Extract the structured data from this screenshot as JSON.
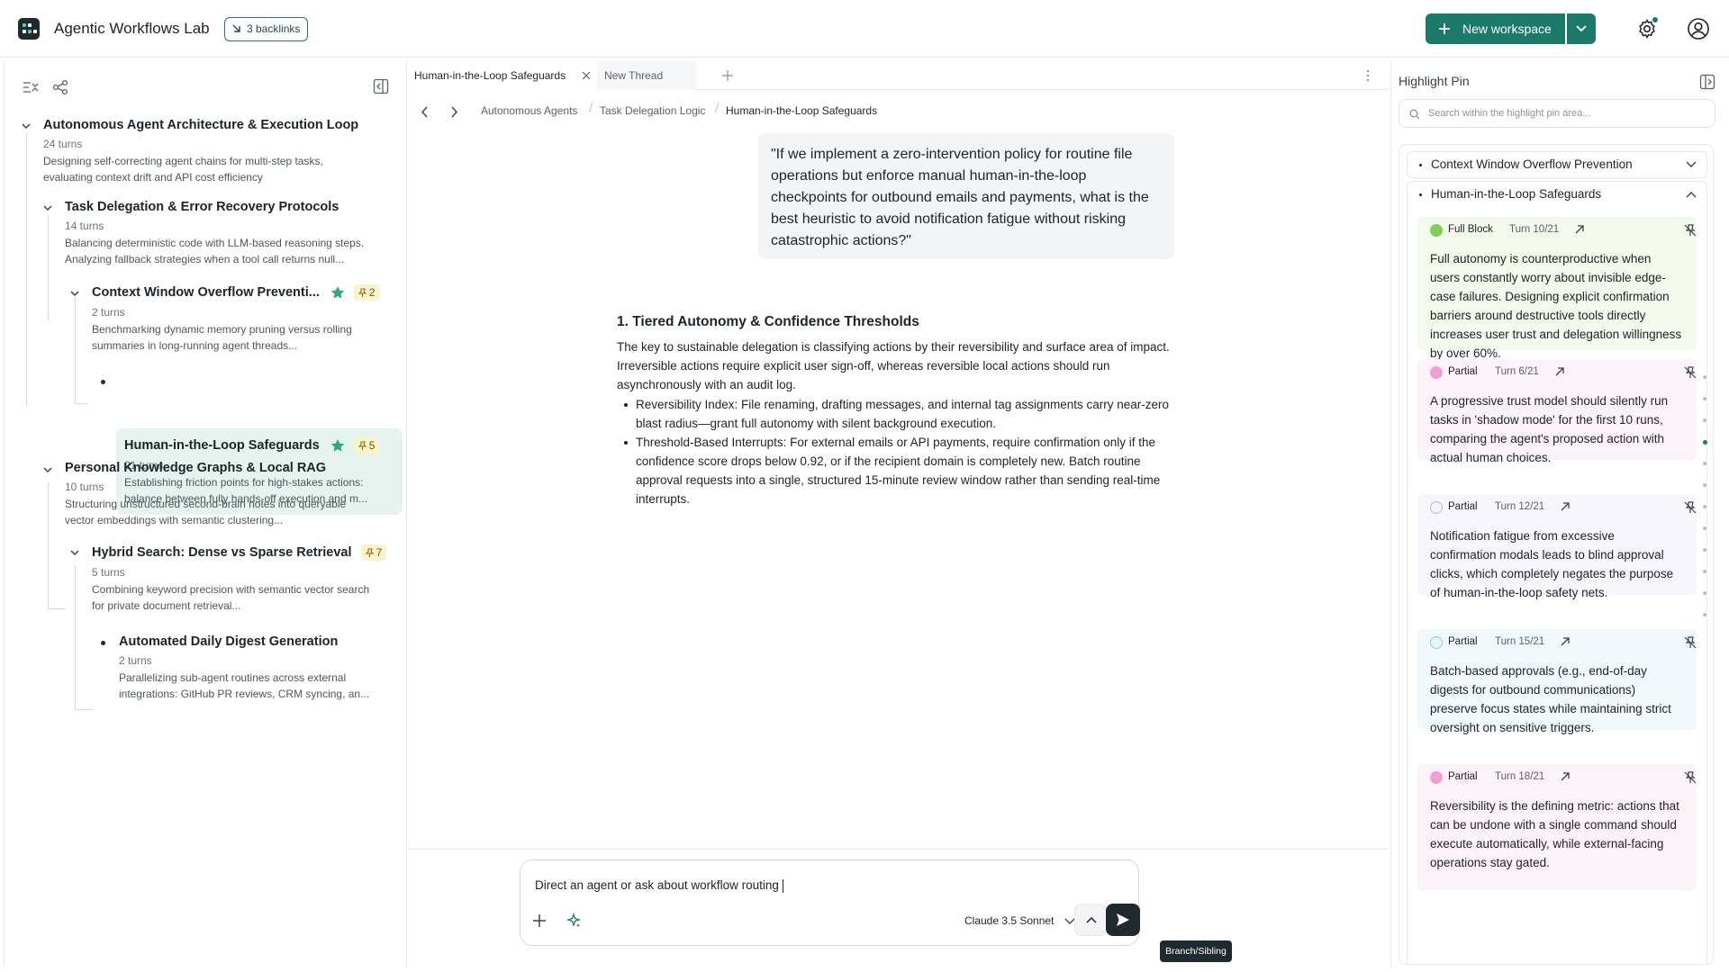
{
  "app": {
    "title": "Agentic Workflows Lab",
    "backlinks": "3 backlinks"
  },
  "toolbar": {
    "new_workspace": "New workspace"
  },
  "tree": [
    {
      "title": "Autonomous Agent Architecture & Execution Loop",
      "turns": "24 turns",
      "desc": "Designing self-correcting agent chains for multi-step tasks, evaluating context drift and API cost efficiency"
    },
    {
      "title": "Task Delegation & Error Recovery Protocols",
      "turns": "14 turns",
      "desc": "Balancing deterministic code with LLM-based reasoning steps. Analyzing fallback strategies when a tool call returns null..."
    },
    {
      "title": "Context Window Overflow Preventi...",
      "turns": "2 turns",
      "desc": "Benchmarking dynamic memory pruning versus rolling summaries in long-running agent threads...",
      "pins": "2"
    },
    {
      "title": "Human-in-the-Loop Safeguards",
      "turns": "21 turns",
      "desc": "Establishing friction points for high-stakes actions: balance between fully hands-off execution and m...",
      "pins": "5"
    },
    {
      "title": "Personal Knowledge Graphs & Local RAG",
      "turns": "10 turns",
      "desc": "Structuring unstructured second-brain notes into queryable vector embeddings with semantic clustering..."
    },
    {
      "title": "Hybrid Search: Dense vs Sparse Retrieval",
      "turns": "5 turns",
      "desc": "Combining keyword precision with semantic vector search for private document retrieval...",
      "pins": "7"
    },
    {
      "title": "Automated Daily Digest Generation",
      "turns": "2 turns",
      "desc": "Parallelizing sub-agent routines across external integrations: GitHub PR reviews, CRM syncing, an..."
    }
  ],
  "tabs": [
    "Human-in-the-Loop Safeguards",
    "New Thread"
  ],
  "breadcrumbs": [
    "Autonomous Agents",
    "Task Delegation Logic",
    "Human-in-the-Loop Safeguards"
  ],
  "chat": {
    "user_quote": "\"If we implement a zero-intervention policy for routine file operations but enforce manual human-in-the-loop checkpoints for outbound emails and payments, what is the best heuristic to avoid notification fatigue without risking catastrophic actions?\"",
    "heading": "1. Tiered Autonomy & Confidence Thresholds",
    "paragraph": "The key to sustainable delegation is classifying actions by their reversibility and surface area of impact. Irreversible actions require explicit user sign-off, whereas reversible local actions should run asynchronously with an audit log.",
    "bullets": [
      "Reversibility Index: File renaming, drafting messages, and internal tag assignments carry near-zero blast radius—grant full autonomy with silent background execution.",
      "Threshold-Based Interrupts: For external emails or API payments, require confirmation only if the confidence score drops below 0.92, or if the recipient domain is completely new. Batch routine approval requests into a single, structured 15-minute review window rather than sending real-time interrupts."
    ]
  },
  "composer": {
    "text": "Direct an agent or ask about workflow routing",
    "model": "Claude 3.5 Sonnet",
    "tooltip": "Branch/Sibling"
  },
  "pin_panel": {
    "title": "Highlight Pin",
    "search_placeholder": "Search within the highlight pin area...",
    "sections": [
      "Context Window Overflow Prevention",
      "Human-in-the-Loop Safeguards"
    ],
    "cards": [
      {
        "tag": "Full Block",
        "turn": "Turn 10/21",
        "color": "#7fcf5a",
        "bg": "#f3f9ec",
        "text": "Full autonomy is counterproductive when users constantly worry about invisible edge-case failures. Designing explicit confirmation barriers around destructive tools directly increases user trust and delegation willingness by over 60%."
      },
      {
        "tag": "Partial",
        "turn": "Turn 6/21",
        "color": "#f0a0d0",
        "bg": "#fbf3f8",
        "text": "A progressive trust model should silently run tasks in 'shadow mode' for the first 10 runs, comparing the agent's proposed action with actual human choices."
      },
      {
        "tag": "Partial",
        "turn": "Turn 12/21",
        "color": "#e6e2f4",
        "bg": "#f7f6fc",
        "text": "Notification fatigue from excessive confirmation modals leads to blind approval clicks, which completely negates the purpose of human-in-the-loop safety nets."
      },
      {
        "tag": "Partial",
        "turn": "Turn 15/21",
        "color": "#d4eef6",
        "bg": "#f0f8fb",
        "text": "Batch-based approvals (e.g., end-of-day digests for outbound communications) preserve focus states while maintaining strict oversight on sensitive triggers."
      },
      {
        "tag": "Partial",
        "turn": "Turn 18/21",
        "color": "#f0a0d0",
        "bg": "#fbf3f8",
        "text": "Reversibility is the defining metric: actions that can be undone with a single command should execute automatically, while external-facing operations stay gated."
      }
    ]
  }
}
